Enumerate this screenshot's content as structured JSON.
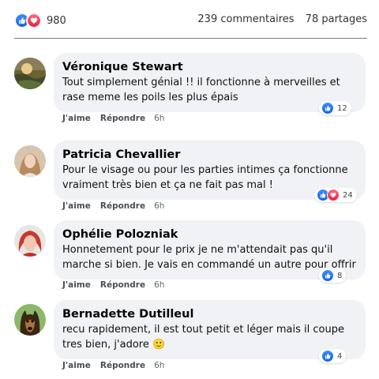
{
  "summary": {
    "reaction_count": "980",
    "comments": "239 commentaires",
    "shares": "78 partages"
  },
  "comments": [
    {
      "name": "Véronique Stewart",
      "text": "Tout simplement génial !! il fonctionne à merveilles et rase meme les poils les plus épais",
      "like_label": "J'aime",
      "reply_label": "Répondre",
      "time": "6h",
      "reactions": [
        "like-icon"
      ],
      "reaction_count": "12"
    },
    {
      "name": "Patricia Chevallier",
      "text": "Pour le visage ou pour les parties intimes ça fonctionne vraiment très bien et ça ne fait pas mal !",
      "like_label": "J'aime",
      "reply_label": "Répondre",
      "time": "6h",
      "reactions": [
        "like-icon",
        "heart-icon"
      ],
      "reaction_count": "24"
    },
    {
      "name": "Ophélie Polozniak",
      "text": "Honnetement pour le prix je ne m'attendait pas qu'il marche si bien. Je vais en commandé un autre pour offrir",
      "like_label": "J'aime",
      "reply_label": "Répondre",
      "time": "6h",
      "reactions": [
        "like-icon"
      ],
      "reaction_count": "8"
    },
    {
      "name": "Bernadette Dutilleul",
      "text": "recu rapidement, il est tout petit et léger mais il coupe tres bien, j'adore 🙂",
      "like_label": "J'aime",
      "reply_label": "Répondre",
      "time": "6h",
      "reactions": [
        "like-icon"
      ],
      "reaction_count": "4"
    }
  ],
  "colors": {
    "like_blue": "#1877f2",
    "love_red": "#f33e58",
    "bubble_bg": "#f0f2f5"
  }
}
